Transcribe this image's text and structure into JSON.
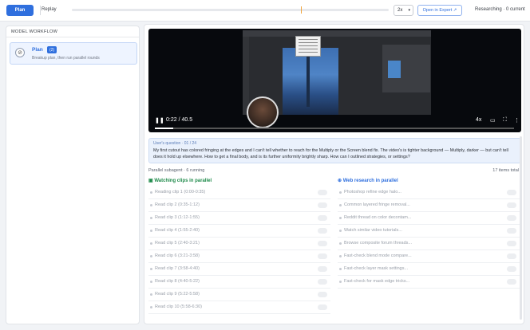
{
  "topbar": {
    "plan_label": "Plan",
    "replay_label": "Replay",
    "speed_value": "2x",
    "speed_chevron": "chevron-down-icon",
    "open_label": "Open in Expert ↗",
    "status": "Researching · 0 current"
  },
  "left_panel": {
    "header": "MODEL WORKFLOW",
    "item": {
      "title": "Plan",
      "badge": "(2)",
      "subtitle": "Breakup plan, then run parallel rounds",
      "icon": "compass-icon"
    }
  },
  "video": {
    "time": "0:22 / 40.5",
    "progress_fraction": 0.05,
    "controls": {
      "pause_icon": "pause-icon",
      "volume_label": "4x",
      "captions_icon": "captions-icon",
      "fullscreen_icon": "fullscreen-icon",
      "more_icon": "more-icon"
    }
  },
  "message": {
    "header": "User's question · 01 / 24",
    "body": "My first cutout has colored fringing at the edges and I can't tell whether to reach for the Multiply or the Screen blend fix. The video's is tighter background — Multiply, darker — but can't tell does it hold up elsewhere. How to get a final body, and is its further uniformity brightly sharp. How can I outlined strategies, or settings?"
  },
  "subagents": {
    "header": "Parallel subagent · 6 running",
    "count": "17 items total",
    "left_title": "Watching clips in parallel",
    "right_title": "Web research in parallel",
    "left_rows": [
      "Reading clip 1 (0:00-0:35)",
      "Read clip 2 (0:35-1:12)",
      "Read clip 3 (1:12-1:55)",
      "Read clip 4 (1:55-2:40)",
      "Read clip 5 (2:40-3:21)",
      "Read clip 6 (3:21-3:58)",
      "Read clip 7 (3:58-4:40)",
      "Read clip 8 (4:40-5:22)",
      "Read clip 9 (5:22-5:58)",
      "Read clip 10 (5:58-6:30)"
    ],
    "right_rows": [
      "Photoshop refine edge halo...",
      "Common layered fringe removal...",
      "Reddit thread on color decontam...",
      "Watch similar video tutorials...",
      "Browse composite forum threads...",
      "Fast-check blend mode compare...",
      "Fast-check layer mask settings...",
      "Fast-check for mask edge tricks..."
    ]
  }
}
